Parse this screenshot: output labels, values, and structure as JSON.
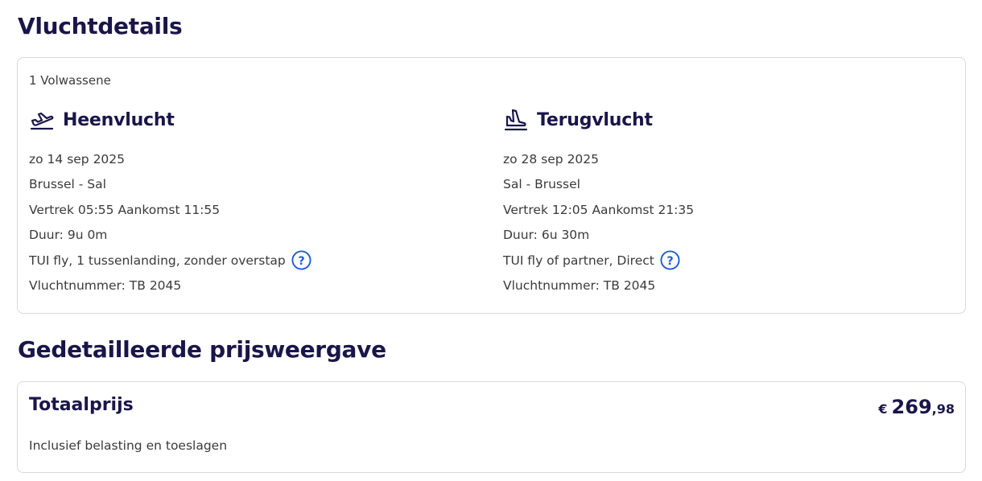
{
  "flight_details": {
    "title": "Vluchtdetails",
    "passengers": "1 Volwassene",
    "outbound": {
      "title": "Heenvlucht",
      "icon": "plane-takeoff-icon",
      "date": "zo 14 sep 2025",
      "route": "Brussel - Sal",
      "times": "Vertrek 05:55 Aankomst 11:55",
      "duration": "Duur: 9u 0m",
      "carrier": "TUI fly, 1 tussenlanding, zonder overstap",
      "flight_number": "Vluchtnummer: TB 2045"
    },
    "return": {
      "title": "Terugvlucht",
      "icon": "plane-landing-icon",
      "date": "zo 28 sep 2025",
      "route": "Sal - Brussel",
      "times": "Vertrek 12:05 Aankomst 21:35",
      "duration": "Duur: 6u 30m",
      "carrier": "TUI fly of partner, Direct",
      "flight_number": "Vluchtnummer: TB 2045"
    }
  },
  "price": {
    "title": "Gedetailleerde prijsweergave",
    "total_label": "Totaalprijs",
    "currency": "€",
    "amount_int": "269",
    "amount_dec": ",98",
    "note": "Inclusief belasting en toeslagen"
  },
  "colors": {
    "heading": "#1a1549",
    "help_icon": "#1f5bd6",
    "border": "#d9d9df"
  }
}
